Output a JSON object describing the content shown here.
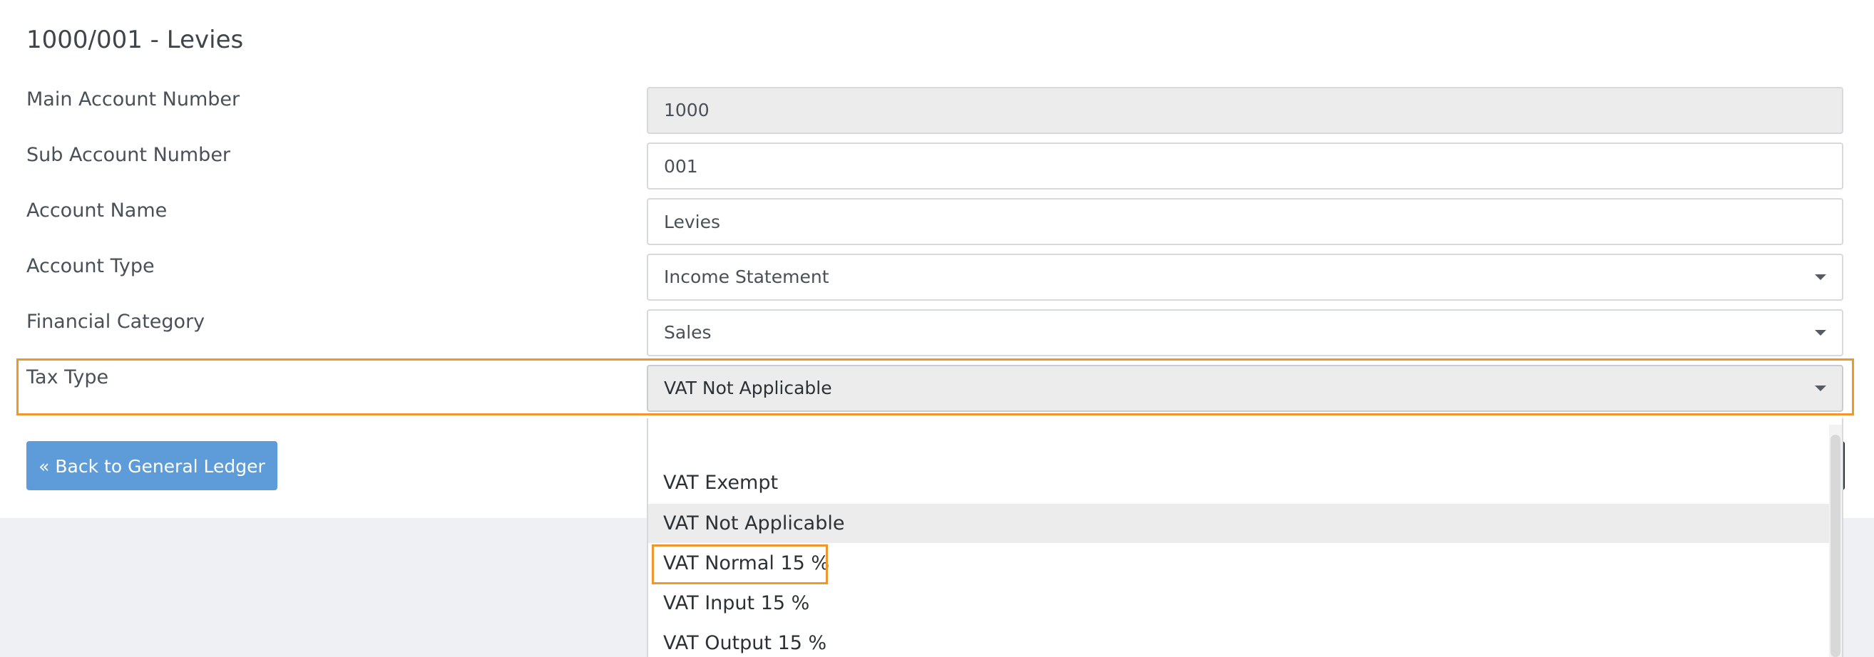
{
  "page_title": "1000/001 - Levies",
  "form": {
    "main_account_number": {
      "label": "Main Account Number",
      "value": "1000"
    },
    "sub_account_number": {
      "label": "Sub Account Number",
      "value": "001"
    },
    "account_name": {
      "label": "Account Name",
      "value": "Levies"
    },
    "account_type": {
      "label": "Account Type",
      "value": "Income Statement"
    },
    "financial_category": {
      "label": "Financial Category",
      "value": "Sales"
    },
    "tax_type": {
      "label": "Tax Type",
      "value": "VAT Not Applicable"
    }
  },
  "buttons": {
    "back": "« Back to General Ledger"
  },
  "tax_type_dropdown": {
    "search_value": "",
    "options": [
      "VAT Exempt",
      "VAT Not Applicable",
      "VAT Normal 15 %",
      "VAT Input 15 %",
      "VAT Output 15 %"
    ],
    "selected_option": "VAT Not Applicable",
    "highlighted_option": "VAT Normal 15 %"
  },
  "colors": {
    "highlight": "#f0962e",
    "primary_button": "#5d9cd8",
    "page_background": "#eef0f4"
  },
  "icons": {
    "select_caret": "chevron-down-icon",
    "back_arrow": "double-angle-left-icon"
  }
}
